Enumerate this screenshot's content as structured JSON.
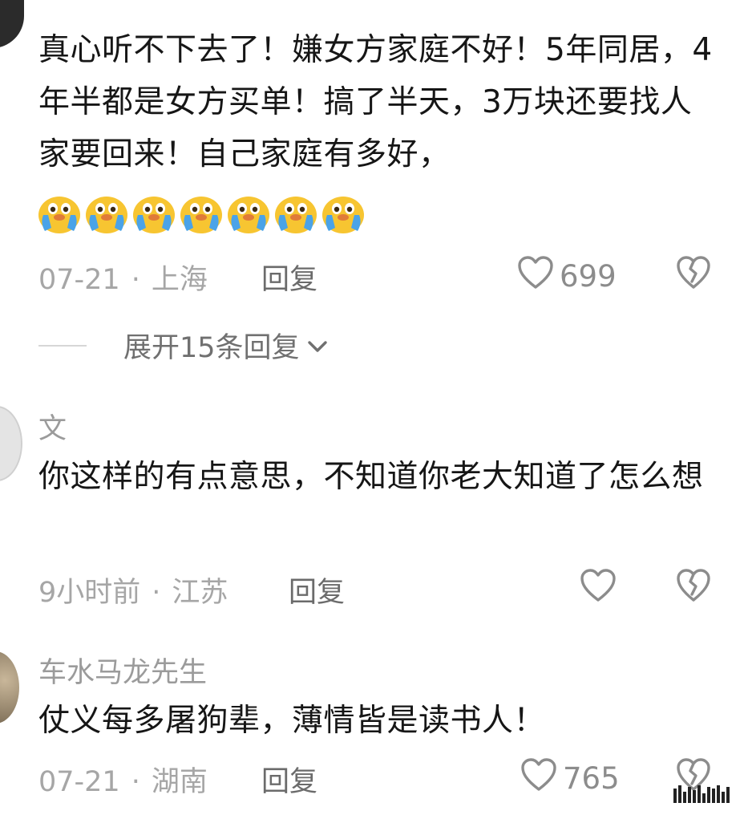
{
  "comments": [
    {
      "username": "",
      "text": "真心听不下去了！嫌女方家庭不好！5年同居，4年半都是女方买单！搞了半天，3万块还要找人家要回来！自己家庭有多好，",
      "emoji_count": 7,
      "emoji": "crying-face-emoji",
      "date": "07-21",
      "location": "上海",
      "reply_label": "回复",
      "likes": "699",
      "expand_label": "展开15条回复"
    },
    {
      "username": "文",
      "text": "你这样的有点意思，不知道你老大知道了怎么想",
      "date": "9小时前",
      "location": "江苏",
      "reply_label": "回复",
      "likes": ""
    },
    {
      "username": "车水马龙先生",
      "text": "仗义每多屠狗辈，薄情皆是读书人！",
      "date": "07-21",
      "location": "湖南",
      "reply_label": "回复",
      "likes": "765"
    }
  ],
  "colors": {
    "text": "#161616",
    "meta": "#a6a6a6",
    "icon": "#8c8c8c",
    "emoji_face": "#f7c531",
    "emoji_tear": "#4aa3e8"
  }
}
